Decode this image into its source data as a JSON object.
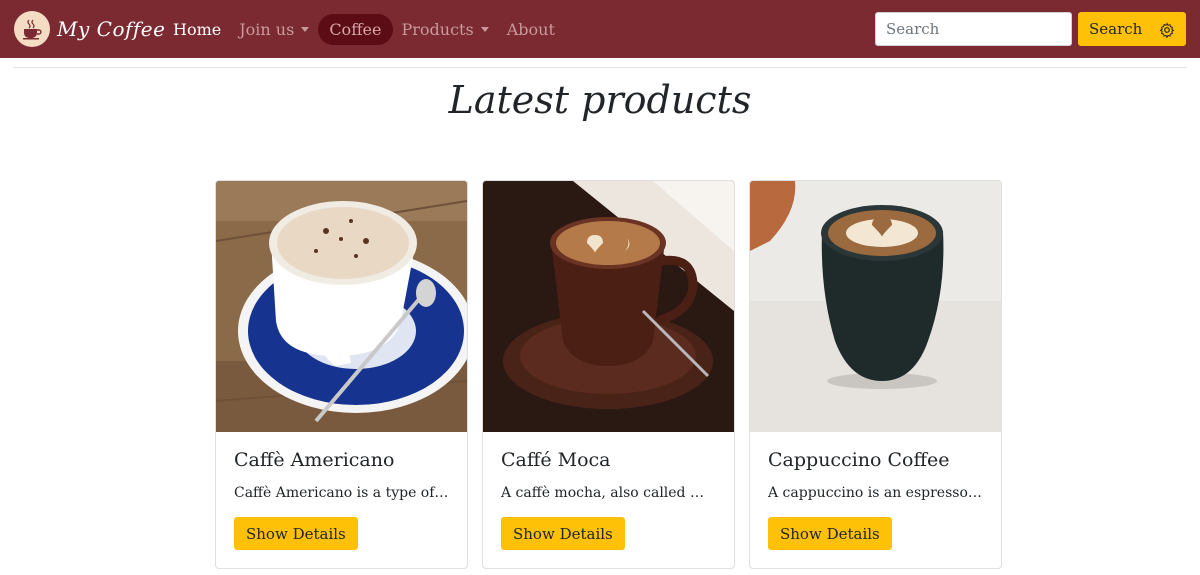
{
  "navbar": {
    "brand": "My Coffee",
    "links": [
      {
        "label": "Home"
      },
      {
        "label": "Join us",
        "dropdown": true
      },
      {
        "label": "Coffee",
        "active": true
      },
      {
        "label": "Products",
        "dropdown": true
      },
      {
        "label": "About"
      }
    ],
    "search_placeholder": "Search",
    "search_button": "Search",
    "colors": {
      "navbar": "#7b2a31",
      "active_pill": "#5c0c14",
      "accent": "#ffc107"
    }
  },
  "main": {
    "title": "Latest products",
    "cards": [
      {
        "title": "Caffè Americano",
        "text": "Caffè Americano is a type of coffee drink",
        "button": "Show Details",
        "image": "americano-photo"
      },
      {
        "title": "Caffé Moca",
        "text": "A caffè mocha, also called mocaccino",
        "button": "Show Details",
        "image": "mocha-photo"
      },
      {
        "title": "Cappuccino Coffee",
        "text": "A cappuccino is an espresso-based drink",
        "button": "Show Details",
        "image": "cappuccino-photo"
      }
    ]
  }
}
